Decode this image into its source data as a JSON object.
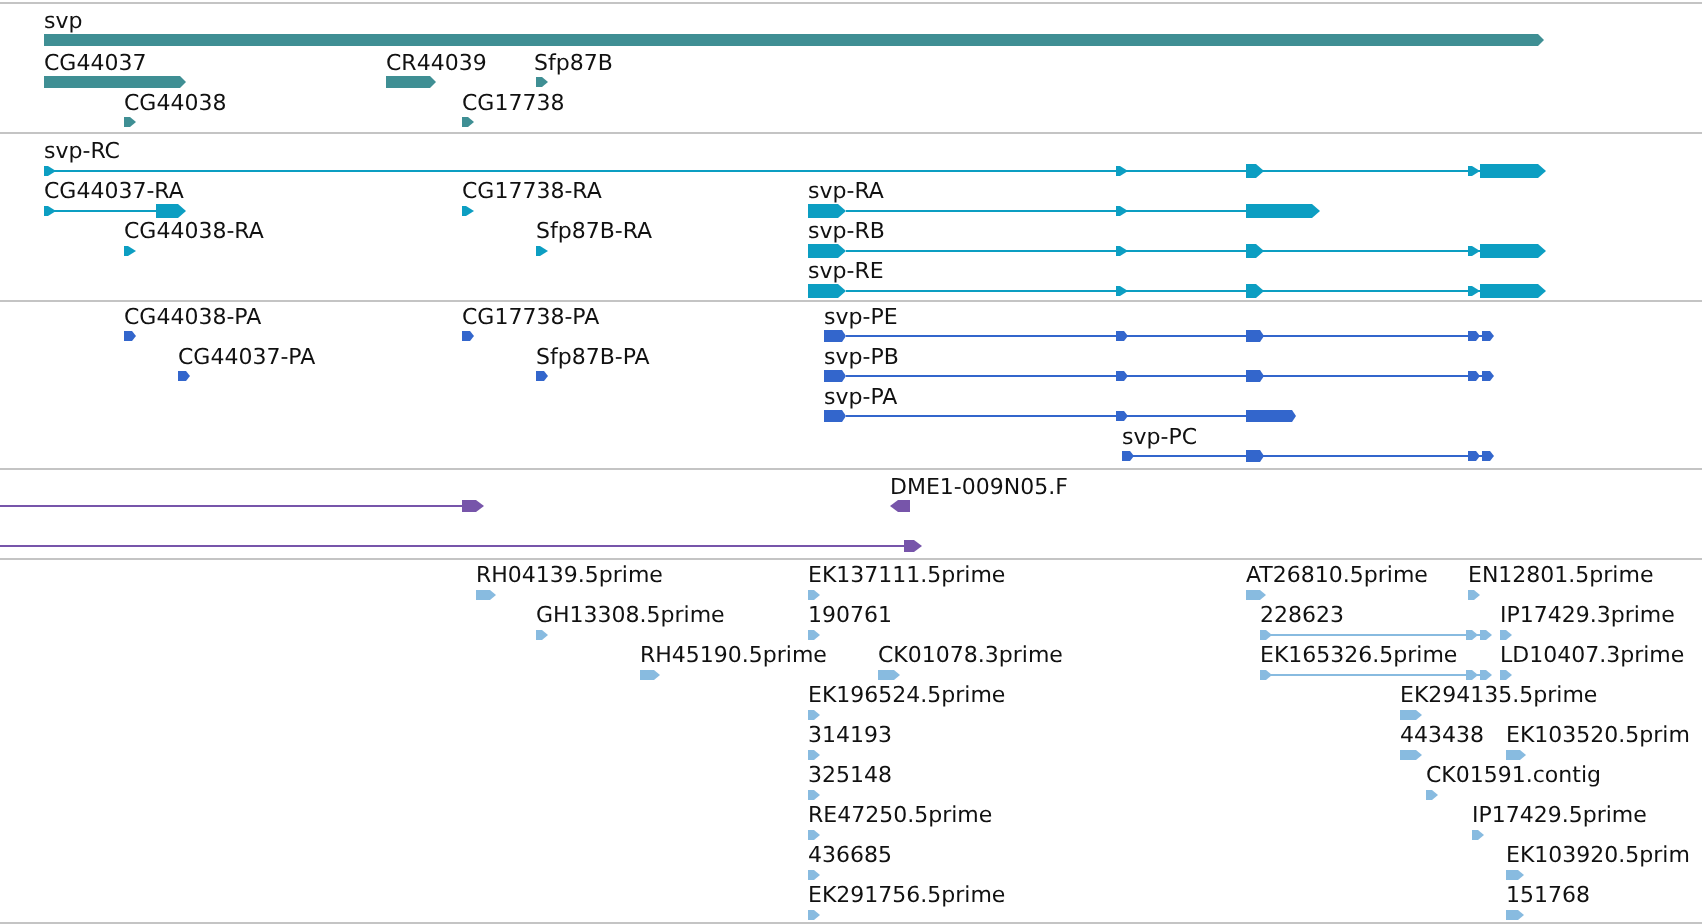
{
  "tracks": [
    {
      "kind": "gene",
      "color": "#3f8f94",
      "features": [
        {
          "label": "svp",
          "reverse": false
        },
        {
          "label": "CG44037",
          "reverse": false
        },
        {
          "label": "CR44039",
          "reverse": false
        },
        {
          "label": "Sfp87B",
          "reverse": false
        },
        {
          "label": "CG44038",
          "reverse": false
        },
        {
          "label": "CG17738",
          "reverse": false
        }
      ]
    },
    {
      "kind": "transcript",
      "color": "#0c9ec2",
      "features": [
        {
          "label": "svp-RC",
          "reverse": false
        },
        {
          "label": "CG44037-RA",
          "reverse": false
        },
        {
          "label": "CG17738-RA",
          "reverse": false
        },
        {
          "label": "svp-RA",
          "reverse": false
        },
        {
          "label": "CG44038-RA",
          "reverse": false
        },
        {
          "label": "Sfp87B-RA",
          "reverse": false
        },
        {
          "label": "svp-RB",
          "reverse": false
        },
        {
          "label": "svp-RE",
          "reverse": false
        }
      ]
    },
    {
      "kind": "protein",
      "color": "#3366cc",
      "features": [
        {
          "label": "CG44038-PA",
          "reverse": false
        },
        {
          "label": "CG17738-PA",
          "reverse": false
        },
        {
          "label": "svp-PE",
          "reverse": false
        },
        {
          "label": "CG44037-PA",
          "reverse": false
        },
        {
          "label": "Sfp87B-PA",
          "reverse": false
        },
        {
          "label": "svp-PB",
          "reverse": false
        },
        {
          "label": "svp-PA",
          "reverse": false
        },
        {
          "label": "svp-PC",
          "reverse": false
        }
      ]
    },
    {
      "kind": "alignment",
      "color": "#7755aa",
      "features": [
        {
          "reverse": false
        },
        {
          "label": "DME1-009N05.F",
          "reverse": true
        },
        {
          "reverse": false
        }
      ]
    },
    {
      "kind": "est",
      "color": "#88bbe0",
      "features": [
        {
          "label": "RH04139.5prime",
          "reverse": false
        },
        {
          "label": "EK137111.5prime",
          "reverse": false
        },
        {
          "label": "AT26810.5prime",
          "reverse": false
        },
        {
          "label": "EN12801.5prime",
          "reverse": false
        },
        {
          "label": "GH13308.5prime",
          "reverse": false
        },
        {
          "label": "190761",
          "reverse": false
        },
        {
          "label": "228623",
          "reverse": false
        },
        {
          "label": "IP17429.3prime",
          "reverse": false
        },
        {
          "label": "RH45190.5prime",
          "reverse": false
        },
        {
          "label": "CK01078.3prime",
          "reverse": false
        },
        {
          "label": "EK165326.5prime",
          "reverse": false
        },
        {
          "label": "LD10407.3prime",
          "reverse": false
        },
        {
          "label": "EK196524.5prime",
          "reverse": false
        },
        {
          "label": "EK294135.5prime",
          "reverse": false
        },
        {
          "label": "314193",
          "reverse": false
        },
        {
          "label": "443438",
          "reverse": false
        },
        {
          "label": "EK103520.5prim",
          "reverse": false
        },
        {
          "label": "325148",
          "reverse": false
        },
        {
          "label": "CK01591.contig",
          "reverse": false
        },
        {
          "label": "RE47250.5prime",
          "reverse": false
        },
        {
          "label": "IP17429.5prime",
          "reverse": false
        },
        {
          "label": "436685",
          "reverse": false
        },
        {
          "label": "EK103920.5prim",
          "reverse": false
        },
        {
          "label": "EK291756.5prime",
          "reverse": false
        },
        {
          "label": "151768",
          "reverse": false
        }
      ]
    }
  ]
}
